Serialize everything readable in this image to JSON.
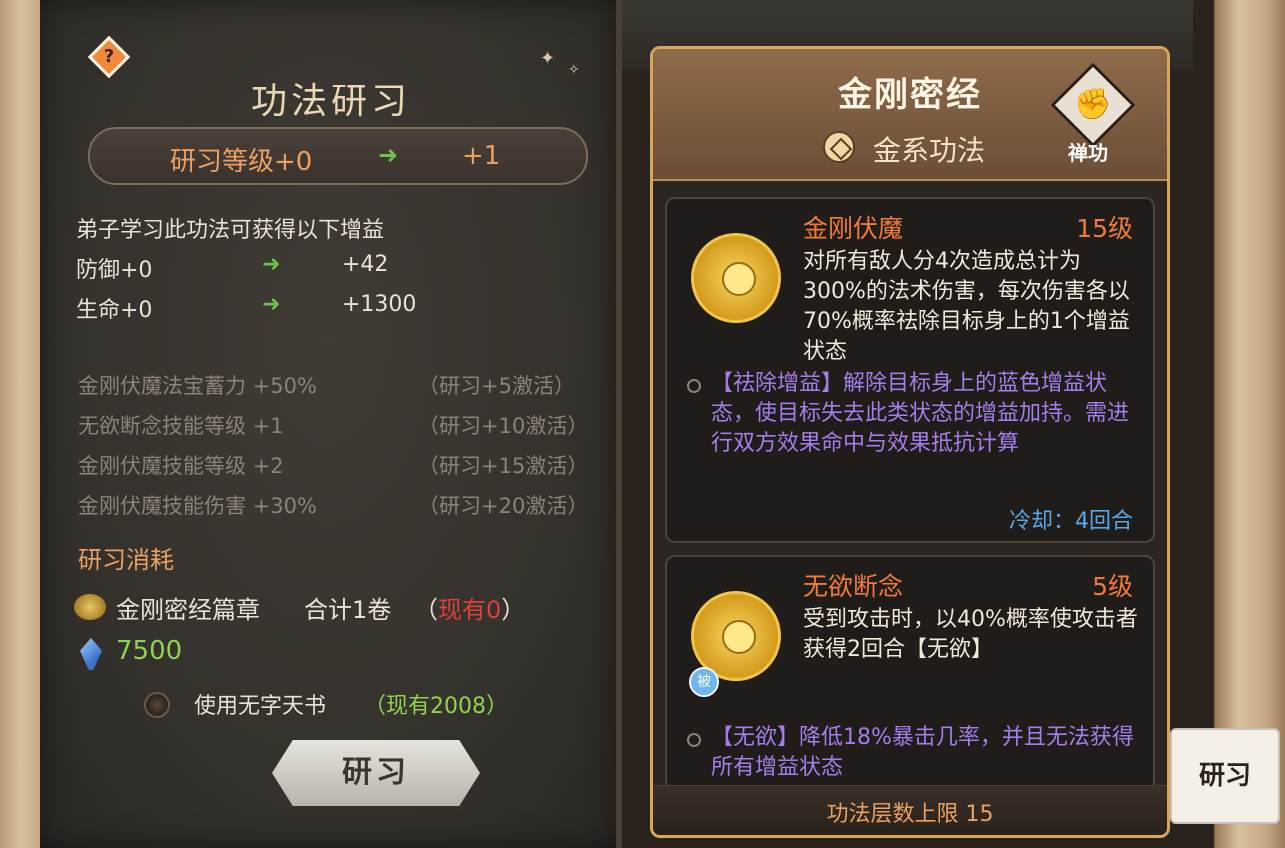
{
  "left_page": {
    "help_label": "?",
    "title": "功法研习",
    "level": {
      "from": "研习等级+0",
      "arrow": "➜",
      "to": "+1"
    },
    "gain_intro": "弟子学习此功法可获得以下增益",
    "stats": [
      {
        "name": "防御+0",
        "arrow": "➜",
        "value": "+42"
      },
      {
        "name": "生命+0",
        "arrow": "➜",
        "value": "+1300"
      }
    ],
    "bonuses": [
      {
        "text": "金刚伏魔法宝蓄力 +50%",
        "condition": "（研习+5激活）"
      },
      {
        "text": "无欲断念技能等级 +1",
        "condition": "（研习+10激活）"
      },
      {
        "text": "金刚伏魔技能等级 +2",
        "condition": "（研习+15激活）"
      },
      {
        "text": "金刚伏魔技能伤害 +30%",
        "condition": "（研习+20激活）"
      }
    ],
    "cost_title": "研习消耗",
    "cost_item": {
      "name": "金刚密经篇章",
      "total": "合计1卷",
      "have_open": "（",
      "have_label": "现有0",
      "have_close": "）"
    },
    "crystal_value": "7500",
    "use_book": {
      "label": "使用无字天书",
      "have": "（现有2008）"
    },
    "study_button": "研习"
  },
  "right_panel": {
    "title": "金刚密经",
    "element_label": "金系功法",
    "type_glyph": "✊",
    "type_label": "禅功",
    "skills": [
      {
        "name": "金刚伏魔",
        "level": "15级",
        "description": "对所有敌人分4次造成总计为300%的法术伤害，每次伤害各以70%概率祛除目标身上的1个增益状态",
        "note": "【祛除增益】解除目标身上的蓝色增益状态，使目标失去此类状态的增益加持。需进行双方效果命中与效果抵抗计算",
        "cooldown": "冷却：4回合"
      },
      {
        "name": "无欲断念",
        "level": "5级",
        "passive_badge": "被",
        "description": "受到攻击时，以40%概率使攻击者获得2回合【无欲】",
        "note": "【无欲】降低18%暴击几率，并且无法获得所有增益状态"
      }
    ],
    "footer": "功法层数上限 15"
  },
  "side_button": "研习",
  "colors": {
    "accent_orange": "#e9a062",
    "skill_orange": "#f07a3a",
    "green": "#6cc24a",
    "purple_note": "#a67de8",
    "cooldown_blue": "#5aa6e8",
    "red": "#e0403a",
    "panel_border": "#d9a45c"
  }
}
